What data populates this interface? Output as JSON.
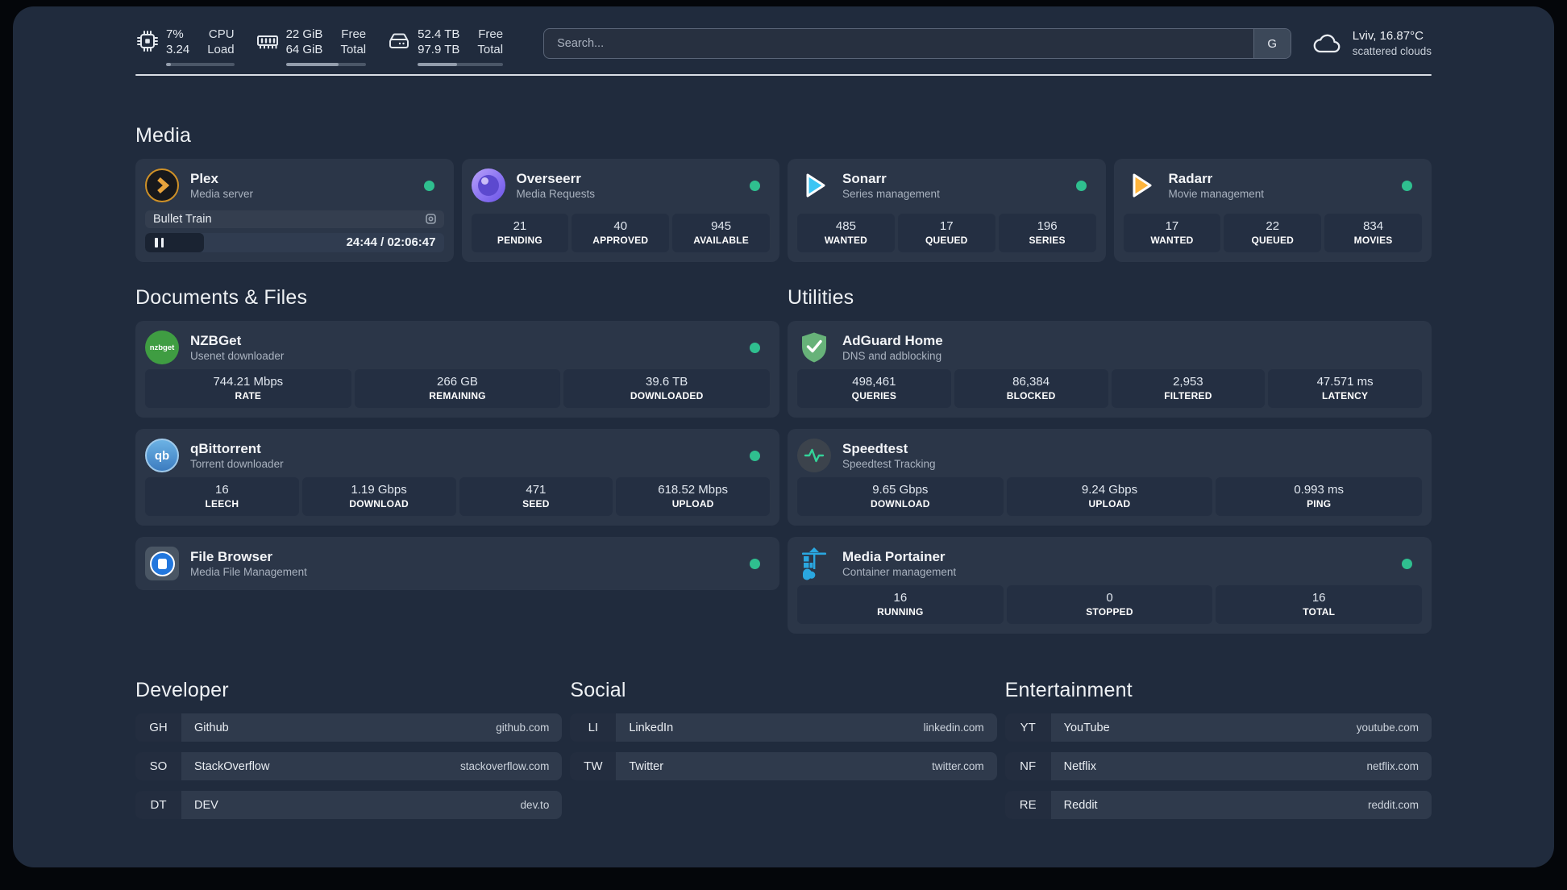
{
  "colors": {
    "status_online": "#2fbf8f",
    "plex_accent": "#e5a00d",
    "sonarr_accent": "#3cc5f4",
    "radarr_accent": "#ffb53c",
    "nzbget_accent": "#3f9d42",
    "qbittorrent_accent": "#4f9bd9",
    "adguard_accent": "#67b279",
    "speedtest_accent": "#34d399",
    "filebrowser_accent": "#2277dd",
    "portainer_accent": "#2aa7e0"
  },
  "topbar": {
    "cpu": {
      "values": [
        "7%",
        "3.24"
      ],
      "labels": [
        "CPU",
        "Load"
      ],
      "progress_pct": 7
    },
    "memory": {
      "values": [
        "22 GiB",
        "64 GiB"
      ],
      "labels": [
        "Free",
        "Total"
      ],
      "progress_pct": 66
    },
    "storage": {
      "values": [
        "52.4 TB",
        "97.9 TB"
      ],
      "labels": [
        "Free",
        "Total"
      ],
      "progress_pct": 46
    },
    "search": {
      "placeholder": "Search...",
      "engine_label": "G"
    },
    "weather": {
      "location": "Lviv, 16.87°C",
      "condition": "scattered clouds"
    }
  },
  "sections": {
    "media": {
      "title": "Media",
      "apps": {
        "plex": {
          "name": "Plex",
          "description": "Media server",
          "status": "online",
          "now_playing": {
            "title": "Bullet Train",
            "time": "24:44 / 02:06:47",
            "progress_pct": 19.6,
            "state": "paused"
          }
        },
        "overseerr": {
          "name": "Overseerr",
          "description": "Media Requests",
          "status": "online",
          "stats": [
            {
              "value": "21",
              "label": "PENDING"
            },
            {
              "value": "40",
              "label": "APPROVED"
            },
            {
              "value": "945",
              "label": "AVAILABLE"
            }
          ]
        },
        "sonarr": {
          "name": "Sonarr",
          "description": "Series management",
          "status": "online",
          "stats": [
            {
              "value": "485",
              "label": "WANTED"
            },
            {
              "value": "17",
              "label": "QUEUED"
            },
            {
              "value": "196",
              "label": "SERIES"
            }
          ]
        },
        "radarr": {
          "name": "Radarr",
          "description": "Movie management",
          "status": "online",
          "stats": [
            {
              "value": "17",
              "label": "WANTED"
            },
            {
              "value": "22",
              "label": "QUEUED"
            },
            {
              "value": "834",
              "label": "MOVIES"
            }
          ]
        }
      }
    },
    "documents": {
      "title": "Documents & Files",
      "apps": {
        "nzbget": {
          "name": "NZBGet",
          "description": "Usenet downloader",
          "status": "online",
          "icon_text": "nzbget",
          "stats": [
            {
              "value": "744.21 Mbps",
              "label": "RATE"
            },
            {
              "value": "266 GB",
              "label": "REMAINING"
            },
            {
              "value": "39.6 TB",
              "label": "DOWNLOADED"
            }
          ]
        },
        "qbittorrent": {
          "name": "qBittorrent",
          "description": "Torrent downloader",
          "status": "online",
          "icon_text": "qb",
          "stats": [
            {
              "value": "16",
              "label": "LEECH"
            },
            {
              "value": "1.19 Gbps",
              "label": "DOWNLOAD"
            },
            {
              "value": "471",
              "label": "SEED"
            },
            {
              "value": "618.52 Mbps",
              "label": "UPLOAD"
            }
          ]
        },
        "filebrowser": {
          "name": "File Browser",
          "description": "Media File Management",
          "status": "online"
        }
      }
    },
    "utilities": {
      "title": "Utilities",
      "apps": {
        "adguard": {
          "name": "AdGuard Home",
          "description": "DNS and adblocking",
          "stats": [
            {
              "value": "498,461",
              "label": "QUERIES"
            },
            {
              "value": "86,384",
              "label": "BLOCKED"
            },
            {
              "value": "2,953",
              "label": "FILTERED"
            },
            {
              "value": "47.571 ms",
              "label": "LATENCY"
            }
          ]
        },
        "speedtest": {
          "name": "Speedtest",
          "description": "Speedtest Tracking",
          "stats": [
            {
              "value": "9.65 Gbps",
              "label": "DOWNLOAD"
            },
            {
              "value": "9.24 Gbps",
              "label": "UPLOAD"
            },
            {
              "value": "0.993 ms",
              "label": "PING"
            }
          ]
        },
        "portainer": {
          "name": "Media Portainer",
          "description": "Container management",
          "status": "online",
          "stats": [
            {
              "value": "16",
              "label": "RUNNING"
            },
            {
              "value": "0",
              "label": "STOPPED"
            },
            {
              "value": "16",
              "label": "TOTAL"
            }
          ]
        }
      }
    },
    "developer": {
      "title": "Developer",
      "bookmarks": [
        {
          "abbr": "GH",
          "name": "Github",
          "url": "github.com"
        },
        {
          "abbr": "SO",
          "name": "StackOverflow",
          "url": "stackoverflow.com"
        },
        {
          "abbr": "DT",
          "name": "DEV",
          "url": "dev.to"
        }
      ]
    },
    "social": {
      "title": "Social",
      "bookmarks": [
        {
          "abbr": "LI",
          "name": "LinkedIn",
          "url": "linkedin.com"
        },
        {
          "abbr": "TW",
          "name": "Twitter",
          "url": "twitter.com"
        }
      ]
    },
    "entertainment": {
      "title": "Entertainment",
      "bookmarks": [
        {
          "abbr": "YT",
          "name": "YouTube",
          "url": "youtube.com"
        },
        {
          "abbr": "NF",
          "name": "Netflix",
          "url": "netflix.com"
        },
        {
          "abbr": "RE",
          "name": "Reddit",
          "url": "reddit.com"
        }
      ]
    }
  }
}
